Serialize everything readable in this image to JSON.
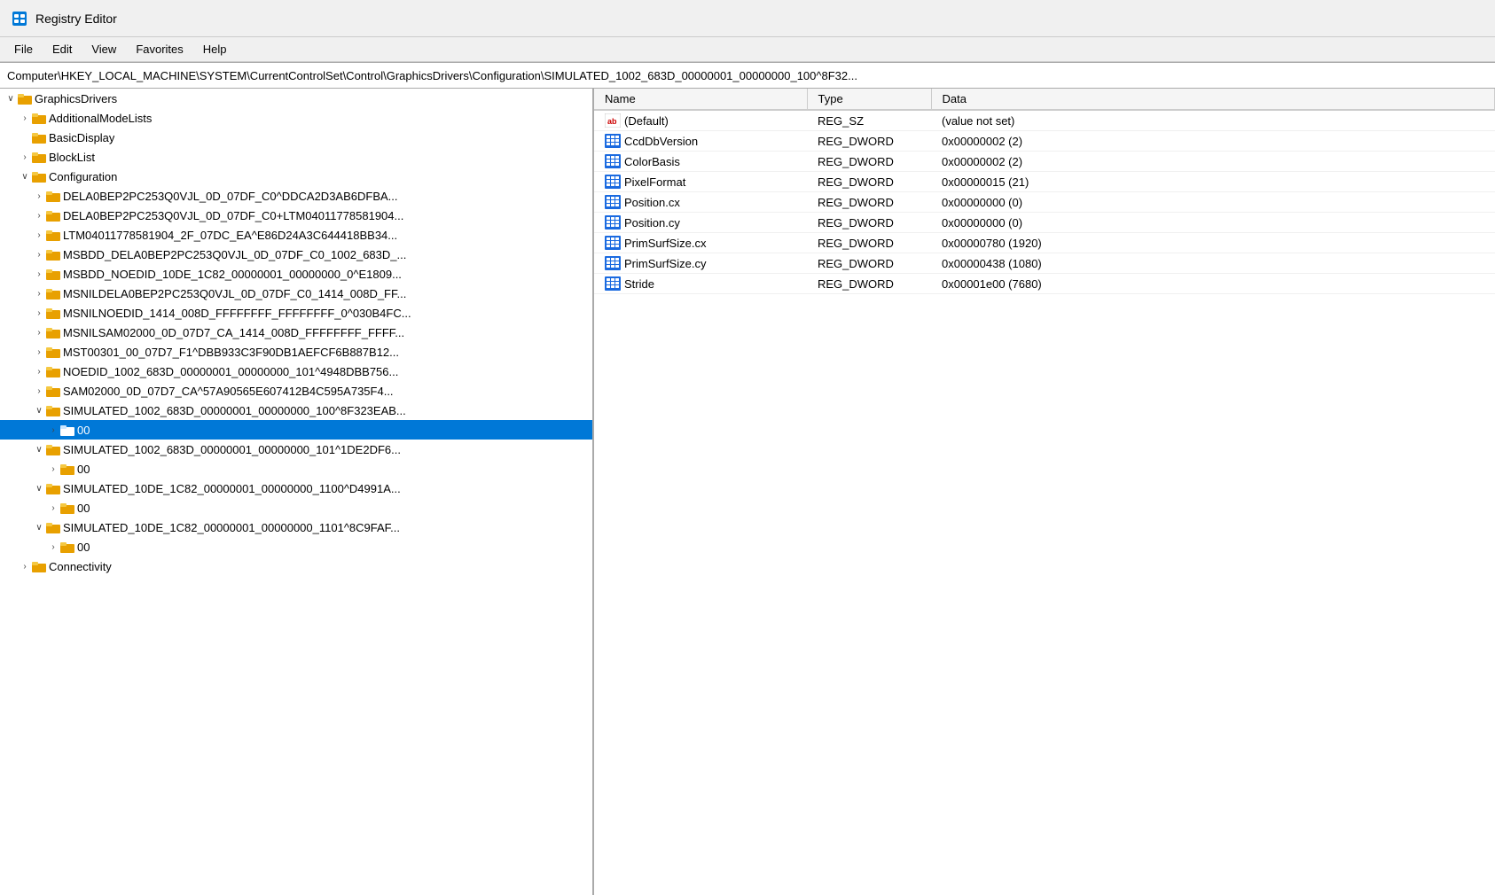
{
  "app": {
    "title": "Registry Editor",
    "icon_label": "registry-editor-icon"
  },
  "menu": {
    "items": [
      "File",
      "Edit",
      "View",
      "Favorites",
      "Help"
    ]
  },
  "address_bar": {
    "path": "Computer\\HKEY_LOCAL_MACHINE\\SYSTEM\\CurrentControlSet\\Control\\GraphicsDrivers\\Configuration\\SIMULATED_1002_683D_00000001_00000000_100^8F32..."
  },
  "tree": {
    "header": "GraphicsDrivers",
    "nodes": [
      {
        "id": "graphicsdrivers",
        "label": "GraphicsDrivers",
        "indent": 0,
        "expanded": true,
        "has_children": true,
        "selected": false
      },
      {
        "id": "additionalmodelists",
        "label": "AdditionalModeLists",
        "indent": 1,
        "expanded": false,
        "has_children": true,
        "selected": false
      },
      {
        "id": "basicdisplay",
        "label": "BasicDisplay",
        "indent": 1,
        "expanded": false,
        "has_children": false,
        "selected": false
      },
      {
        "id": "blocklist",
        "label": "BlockList",
        "indent": 1,
        "expanded": false,
        "has_children": true,
        "selected": false
      },
      {
        "id": "configuration",
        "label": "Configuration",
        "indent": 1,
        "expanded": true,
        "has_children": true,
        "selected": false
      },
      {
        "id": "dela0bep1",
        "label": "DELA0BEP2PC253Q0VJL_0D_07DF_C0^DDCA2D3AB6DFBA...",
        "indent": 2,
        "expanded": false,
        "has_children": true,
        "selected": false
      },
      {
        "id": "dela0bep2",
        "label": "DELA0BEP2PC253Q0VJL_0D_07DF_C0+LTM04011778581904...",
        "indent": 2,
        "expanded": false,
        "has_children": true,
        "selected": false
      },
      {
        "id": "ltm04011",
        "label": "LTM04011778581904_2F_07DC_EA^E86D24A3C644418BB34...",
        "indent": 2,
        "expanded": false,
        "has_children": true,
        "selected": false
      },
      {
        "id": "msbdd_dela",
        "label": "MSBDD_DELA0BEP2PC253Q0VJL_0D_07DF_C0_1002_683D_...",
        "indent": 2,
        "expanded": false,
        "has_children": true,
        "selected": false
      },
      {
        "id": "msbdd_noedid",
        "label": "MSBDD_NOEDID_10DE_1C82_00000001_00000000_0^E1809...",
        "indent": 2,
        "expanded": false,
        "has_children": true,
        "selected": false
      },
      {
        "id": "msnildela",
        "label": "MSNILDELA0BEP2PC253Q0VJL_0D_07DF_C0_1414_008D_FF...",
        "indent": 2,
        "expanded": false,
        "has_children": true,
        "selected": false
      },
      {
        "id": "msnilnoedid",
        "label": "MSNILNOEDID_1414_008D_FFFFFFFF_FFFFFFFF_0^030B4FC...",
        "indent": 2,
        "expanded": false,
        "has_children": true,
        "selected": false
      },
      {
        "id": "msnilsam",
        "label": "MSNILSAM02000_0D_07D7_CA_1414_008D_FFFFFFFF_FFFF...",
        "indent": 2,
        "expanded": false,
        "has_children": true,
        "selected": false
      },
      {
        "id": "mst00301",
        "label": "MST00301_00_07D7_F1^DBB933C3F90DB1AEFCF6B887B12...",
        "indent": 2,
        "expanded": false,
        "has_children": true,
        "selected": false
      },
      {
        "id": "noedid",
        "label": "NOEDID_1002_683D_00000001_00000000_101^4948DBB756...",
        "indent": 2,
        "expanded": false,
        "has_children": true,
        "selected": false
      },
      {
        "id": "sam02000",
        "label": "SAM02000_0D_07D7_CA^57A90565E607412B4C595A735F4...",
        "indent": 2,
        "expanded": false,
        "has_children": true,
        "selected": false
      },
      {
        "id": "simulated1",
        "label": "SIMULATED_1002_683D_00000001_00000000_100^8F323EAB...",
        "indent": 2,
        "expanded": true,
        "has_children": true,
        "selected": false
      },
      {
        "id": "sim1_00",
        "label": "00",
        "indent": 3,
        "expanded": false,
        "has_children": true,
        "selected": true
      },
      {
        "id": "simulated2",
        "label": "SIMULATED_1002_683D_00000001_00000000_101^1DE2DF6...",
        "indent": 2,
        "expanded": true,
        "has_children": true,
        "selected": false
      },
      {
        "id": "sim2_00",
        "label": "00",
        "indent": 3,
        "expanded": false,
        "has_children": true,
        "selected": false
      },
      {
        "id": "simulated3",
        "label": "SIMULATED_10DE_1C82_00000001_00000000_1100^D4991A...",
        "indent": 2,
        "expanded": true,
        "has_children": true,
        "selected": false
      },
      {
        "id": "sim3_00",
        "label": "00",
        "indent": 3,
        "expanded": false,
        "has_children": true,
        "selected": false
      },
      {
        "id": "simulated4",
        "label": "SIMULATED_10DE_1C82_00000001_00000000_1101^8C9FAF...",
        "indent": 2,
        "expanded": true,
        "has_children": true,
        "selected": false
      },
      {
        "id": "sim4_00",
        "label": "00",
        "indent": 3,
        "expanded": false,
        "has_children": true,
        "selected": false
      },
      {
        "id": "connectivity",
        "label": "Connectivity",
        "indent": 1,
        "expanded": false,
        "has_children": true,
        "selected": false
      }
    ]
  },
  "values": {
    "columns": [
      "Name",
      "Type",
      "Data"
    ],
    "rows": [
      {
        "name": "(Default)",
        "type": "REG_SZ",
        "data": "(value not set)",
        "icon": "ab"
      },
      {
        "name": "CcdDbVersion",
        "type": "REG_DWORD",
        "data": "0x00000002 (2)",
        "icon": "dword"
      },
      {
        "name": "ColorBasis",
        "type": "REG_DWORD",
        "data": "0x00000002 (2)",
        "icon": "dword"
      },
      {
        "name": "PixelFormat",
        "type": "REG_DWORD",
        "data": "0x00000015 (21)",
        "icon": "dword"
      },
      {
        "name": "Position.cx",
        "type": "REG_DWORD",
        "data": "0x00000000 (0)",
        "icon": "dword"
      },
      {
        "name": "Position.cy",
        "type": "REG_DWORD",
        "data": "0x00000000 (0)",
        "icon": "dword"
      },
      {
        "name": "PrimSurfSize.cx",
        "type": "REG_DWORD",
        "data": "0x00000780 (1920)",
        "icon": "dword"
      },
      {
        "name": "PrimSurfSize.cy",
        "type": "REG_DWORD",
        "data": "0x00000438 (1080)",
        "icon": "dword"
      },
      {
        "name": "Stride",
        "type": "REG_DWORD",
        "data": "0x00001e00 (7680)",
        "icon": "dword"
      }
    ]
  }
}
